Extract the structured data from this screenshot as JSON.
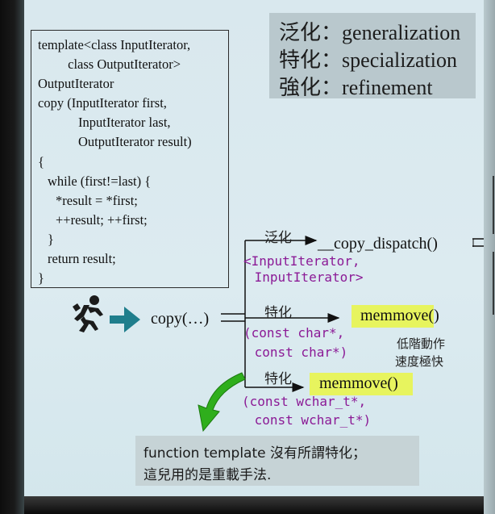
{
  "legend": [
    {
      "zh": "泛化",
      "sep": "：",
      "en": "generalization"
    },
    {
      "zh": "特化",
      "sep": "：",
      "en": "specialization"
    },
    {
      "zh": "強化",
      "sep": "：",
      "en": "refinement"
    }
  ],
  "code": {
    "lines": [
      "template<class InputIterator,",
      "         class OutputIterator>",
      "OutputIterator",
      "copy",
      " (InputIterator first,",
      "InputIterator last,",
      "OutputIterator result)",
      "{",
      "while (first!=last) {",
      "*result = *first;",
      "++result; ++first;",
      "}",
      "return result;",
      "}"
    ]
  },
  "flow": {
    "call_label": "copy(…)",
    "branch_general_label": "泛化",
    "dispatch_label": "__copy_dispatch()",
    "dispatch_args_1": "<InputIterator,",
    "dispatch_args_2": " InputIterator>",
    "branch_special_1_label": "特化",
    "memmove_1": "memmove()",
    "memmove_1_args_1": "(const char*,",
    "memmove_1_args_2": " const char*)",
    "memmove_note_1": "低階動作",
    "memmove_note_2": "速度極快",
    "branch_special_2_label": "特化",
    "memmove_2": "memmove()",
    "memmove_2_args_1": "(const wchar_t*,",
    "memmove_2_args_2": " const wchar_t*)"
  },
  "note": {
    "line1": "function template 沒有所謂特化；",
    "line2": "這兒用的是重載手法."
  },
  "colors": {
    "highlight": "#e7f45e",
    "purple_text": "#8b1a96",
    "keyword_blue": "#2a1ad0",
    "teal_arrow": "#1f7e8c",
    "green_arrow": "#2fae1c"
  }
}
